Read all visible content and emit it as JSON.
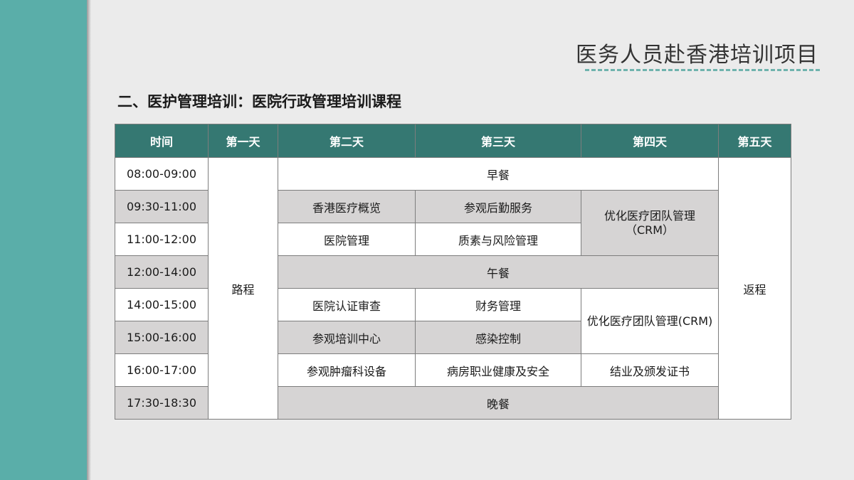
{
  "slide": {
    "header_title": "医务人员赴香港培训项目",
    "section_title": "二、医护管理培训：医院行政管理培训课程"
  },
  "colors": {
    "sidebar": "#5aaea9",
    "table_header": "#357872",
    "header_underline": "#6fb3ad",
    "row_gray": "#d6d4d4"
  },
  "table": {
    "headers": [
      "时间",
      "第一天",
      "第二天",
      "第三天",
      "第四天",
      "第五天"
    ],
    "times": [
      "08:00-09:00",
      "09:30-11:00",
      "11:00-12:00",
      "12:00-14:00",
      "14:00-15:00",
      "15:00-16:00",
      "16:00-17:00",
      "17:30-18:30"
    ],
    "day1": "路程",
    "day5": "返程",
    "breakfast": "早餐",
    "lunch": "午餐",
    "dinner": "晚餐",
    "r2_d2": "香港医疗概览",
    "r2_d3": "参观后勤服务",
    "r23_d4": "优化医疗团队管理（CRM）",
    "r3_d2": "医院管理",
    "r3_d3": "质素与风险管理",
    "r5_d2": "医院认证审查",
    "r5_d3": "财务管理",
    "r56_d4": "优化医疗团队管理(CRM)",
    "r6_d2": "参观培训中心",
    "r6_d3": "感染控制",
    "r7_d2": "参观肿瘤科设备",
    "r7_d3": "病房职业健康及安全",
    "r7_d4": "结业及颁发证书"
  }
}
